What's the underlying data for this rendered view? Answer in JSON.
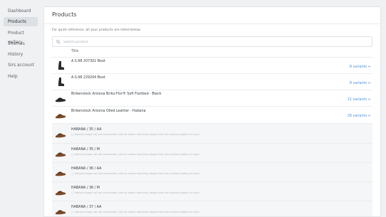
{
  "sidebar": {
    "items": [
      {
        "label": "Dashboard",
        "active": false
      },
      {
        "label": "Products",
        "active": true
      },
      {
        "label": "Product gallery",
        "active": false
      },
      {
        "label": "Themes",
        "active": false
      },
      {
        "label": "History",
        "active": false
      },
      {
        "label": "Sirs account",
        "active": false
      },
      {
        "label": "Help",
        "active": false
      }
    ]
  },
  "main": {
    "title": "Products",
    "intro": "For quick reference, all your products are listed below.",
    "search": {
      "placeholder": "Search product",
      "value": ""
    },
    "column_title": "Title"
  },
  "products": [
    {
      "name": "A.S.98 207302 Boot",
      "variants": "8 variants",
      "thumb": "boot-thumbnail",
      "expanded": false
    },
    {
      "name": "A.S.98 229204 Boot",
      "variants": "8 variants",
      "thumb": "boot-thumbnail",
      "expanded": false
    },
    {
      "name": "Birkenstock Arizona Birko-Flor® Soft Footbed - Black",
      "variants": "21 variants",
      "thumb": "sandal-thumbnail",
      "expanded": false
    },
    {
      "name": "Birkenstock Arizona Oiled Leather - Habana",
      "variants": "26 variants",
      "thumb": "sandal-thumbnail",
      "expanded": true
    }
  ],
  "subvariants": [
    {
      "name": "HABANA / 35 / AA",
      "desc": "▢ Variant image not yet connected; click to select matching image from the product gallery to sync"
    },
    {
      "name": "HABANA / 35 / M",
      "desc": "▢ Variant image not yet connected; click to select matching image from the product gallery to sync"
    },
    {
      "name": "HABANA / 36 / AA",
      "desc": "▢ Variant image not yet connected; click to select matching image from the product gallery to sync"
    },
    {
      "name": "HABANA / 36 / M",
      "desc": "▢ Variant image not yet connected; click to select matching image from the product gallery to sync"
    },
    {
      "name": "HABANA / 37 / AA",
      "desc": "▢ Variant image not yet connected; click to select matching image from the product gallery to sync"
    }
  ],
  "colors": {
    "accent": "#4c8fd6",
    "sidebar_active": "#dde0e4",
    "background": "#f0f1f3"
  }
}
